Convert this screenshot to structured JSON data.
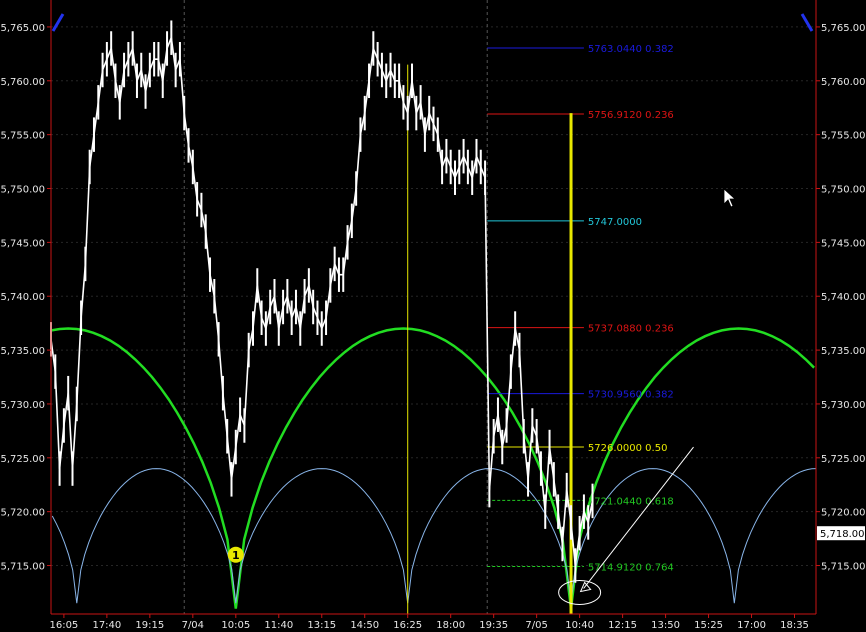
{
  "chart_data": {
    "type": "line",
    "ylim": [
      5710.5,
      5767.5
    ],
    "y_ticks": [
      {
        "label": "5,765.00",
        "value": 5765
      },
      {
        "label": "5,760.00",
        "value": 5760
      },
      {
        "label": "5,755.00",
        "value": 5755
      },
      {
        "label": "5,750.00",
        "value": 5750
      },
      {
        "label": "5,745.00",
        "value": 5745
      },
      {
        "label": "5,740.00",
        "value": 5740
      },
      {
        "label": "5,735.00",
        "value": 5735
      },
      {
        "label": "5,730.00",
        "value": 5730
      },
      {
        "label": "5,725.00",
        "value": 5725
      },
      {
        "label": "5,720.00",
        "value": 5720
      },
      {
        "label": "5,715.00",
        "value": 5715
      }
    ],
    "x_ticks": [
      {
        "label": "16:05",
        "index": 0.6
      },
      {
        "label": "17:40",
        "index": 2.6
      },
      {
        "label": "19:15",
        "index": 4.6
      },
      {
        "label": "7/04",
        "index": 6.6
      },
      {
        "label": "10:05",
        "index": 8.6
      },
      {
        "label": "11:40",
        "index": 10.6
      },
      {
        "label": "13:15",
        "index": 12.6
      },
      {
        "label": "14:50",
        "index": 14.6
      },
      {
        "label": "16:25",
        "index": 16.6
      },
      {
        "label": "18:00",
        "index": 18.6
      },
      {
        "label": "19:35",
        "index": 20.6
      },
      {
        "label": "7/05",
        "index": 22.6
      },
      {
        "label": "10:40",
        "index": 24.6
      },
      {
        "label": "12:15",
        "index": 26.6
      },
      {
        "label": "13:50",
        "index": 28.6
      },
      {
        "label": "15:25",
        "index": 30.6
      },
      {
        "label": "17:00",
        "index": 32.6
      },
      {
        "label": "18:35",
        "index": 34.6
      }
    ],
    "x_range": [
      0,
      35.6
    ],
    "session_breaks": [
      6.2,
      20.3
    ],
    "series": [
      {
        "color": "#ffffff",
        "points": [
          [
            0.0,
            5736
          ],
          [
            0.2,
            5733
          ],
          [
            0.4,
            5724
          ],
          [
            0.6,
            5728
          ],
          [
            0.8,
            5731
          ],
          [
            1.0,
            5724
          ],
          [
            1.2,
            5730
          ],
          [
            1.4,
            5738
          ],
          [
            1.6,
            5743
          ],
          [
            1.8,
            5752
          ],
          [
            2.0,
            5755
          ],
          [
            2.2,
            5758
          ],
          [
            2.4,
            5761
          ],
          [
            2.6,
            5762
          ],
          [
            2.8,
            5763
          ],
          [
            3.0,
            5760
          ],
          [
            3.2,
            5758
          ],
          [
            3.4,
            5761
          ],
          [
            3.6,
            5762
          ],
          [
            3.8,
            5763
          ],
          [
            4.0,
            5760
          ],
          [
            4.2,
            5761
          ],
          [
            4.4,
            5759
          ],
          [
            4.6,
            5761
          ],
          [
            4.8,
            5762
          ],
          [
            5.0,
            5762
          ],
          [
            5.2,
            5760
          ],
          [
            5.4,
            5763
          ],
          [
            5.6,
            5764
          ],
          [
            5.8,
            5761
          ],
          [
            6.0,
            5762
          ],
          [
            6.2,
            5757
          ],
          [
            6.4,
            5754
          ],
          [
            6.6,
            5752
          ],
          [
            6.8,
            5749
          ],
          [
            7.0,
            5748
          ],
          [
            7.2,
            5746
          ],
          [
            7.4,
            5742
          ],
          [
            7.6,
            5740
          ],
          [
            7.8,
            5736
          ],
          [
            8.0,
            5731
          ],
          [
            8.2,
            5727
          ],
          [
            8.4,
            5723
          ],
          [
            8.6,
            5726
          ],
          [
            8.8,
            5729
          ],
          [
            9.0,
            5728
          ],
          [
            9.2,
            5735
          ],
          [
            9.4,
            5737
          ],
          [
            9.6,
            5741
          ],
          [
            9.8,
            5738
          ],
          [
            10.0,
            5737
          ],
          [
            10.2,
            5739
          ],
          [
            10.4,
            5740
          ],
          [
            10.6,
            5737
          ],
          [
            10.8,
            5739
          ],
          [
            11.0,
            5740
          ],
          [
            11.2,
            5738
          ],
          [
            11.4,
            5739
          ],
          [
            11.6,
            5737
          ],
          [
            11.8,
            5740
          ],
          [
            12.0,
            5741
          ],
          [
            12.2,
            5739
          ],
          [
            12.4,
            5738
          ],
          [
            12.6,
            5737
          ],
          [
            12.8,
            5738
          ],
          [
            13.0,
            5741
          ],
          [
            13.2,
            5743
          ],
          [
            13.4,
            5742
          ],
          [
            13.6,
            5742
          ],
          [
            13.8,
            5745
          ],
          [
            14.0,
            5747
          ],
          [
            14.2,
            5750
          ],
          [
            14.4,
            5755
          ],
          [
            14.6,
            5757
          ],
          [
            14.8,
            5760
          ],
          [
            15.0,
            5763
          ],
          [
            15.2,
            5762
          ],
          [
            15.4,
            5761
          ],
          [
            15.6,
            5760
          ],
          [
            15.8,
            5761
          ],
          [
            16.0,
            5760
          ],
          [
            16.2,
            5760
          ],
          [
            16.4,
            5758
          ],
          [
            16.6,
            5757
          ],
          [
            16.8,
            5760
          ],
          [
            17.0,
            5757
          ],
          [
            17.2,
            5758
          ],
          [
            17.4,
            5755
          ],
          [
            17.6,
            5757
          ],
          [
            17.8,
            5756
          ],
          [
            18.0,
            5755
          ],
          [
            18.2,
            5752
          ],
          [
            18.4,
            5753
          ],
          [
            18.6,
            5752
          ],
          [
            18.8,
            5751
          ],
          [
            19.0,
            5752
          ],
          [
            19.2,
            5753
          ],
          [
            19.4,
            5752
          ],
          [
            19.6,
            5751
          ],
          [
            19.8,
            5753
          ],
          [
            20.0,
            5752
          ],
          [
            20.2,
            5751
          ],
          [
            20.4,
            5722
          ],
          [
            20.6,
            5727
          ],
          [
            20.8,
            5729
          ],
          [
            21.0,
            5726
          ],
          [
            21.2,
            5728
          ],
          [
            21.4,
            5733
          ],
          [
            21.6,
            5737
          ],
          [
            21.8,
            5735
          ],
          [
            22.0,
            5727
          ],
          [
            22.2,
            5723
          ],
          [
            22.4,
            5728
          ],
          [
            22.6,
            5727
          ],
          [
            22.8,
            5724
          ],
          [
            23.0,
            5720
          ],
          [
            23.2,
            5726
          ],
          [
            23.4,
            5723
          ],
          [
            23.6,
            5720
          ],
          [
            23.8,
            5717
          ],
          [
            24.0,
            5722
          ],
          [
            24.2,
            5719
          ],
          [
            24.4,
            5715
          ],
          [
            24.6,
            5718
          ],
          [
            24.8,
            5720
          ],
          [
            25.0,
            5719
          ],
          [
            25.2,
            5721
          ]
        ]
      }
    ],
    "fib_levels": [
      {
        "label": "5763.0440 0.382",
        "value": 5763.044,
        "color": "#1a1adc",
        "dashed": false
      },
      {
        "label": "5756.9120 0.236",
        "value": 5756.912,
        "color": "#dc1414",
        "dashed": false
      },
      {
        "label": "5747.0000",
        "value": 5747.0,
        "color": "#22c6d8",
        "dashed": false
      },
      {
        "label": "5737.0880 0.236",
        "value": 5737.088,
        "color": "#dc1414",
        "dashed": false
      },
      {
        "label": "5730.9560 0.382",
        "value": 5730.956,
        "color": "#1a1adc",
        "dashed": false
      },
      {
        "label": "5726.0000 0.50",
        "value": 5726.0,
        "color": "#e8e800",
        "dashed": false
      },
      {
        "label": "5721.0440 0.618",
        "value": 5721.044,
        "color": "#22c822",
        "dashed": true
      },
      {
        "label": "5714.9120 0.764",
        "value": 5714.912,
        "color": "#22c822",
        "dashed": true
      }
    ],
    "fib_x_range": [
      20.3,
      24.8
    ],
    "vertical_markers": [
      {
        "x": 16.6,
        "from": 5710.5,
        "to": 5761.5,
        "color": "#e8e800"
      },
      {
        "x": 24.2,
        "from": 5710.5,
        "to": 5757.0,
        "color": "#e8e800"
      }
    ],
    "cycle_arcs": [
      {
        "color": "#22dd22",
        "troughs": [
          8.6,
          24.2
        ],
        "period": 15.6,
        "peak": 5737.0,
        "trough": 5711.0
      },
      {
        "color": "#88b4e8",
        "troughs": [
          1.2,
          8.6,
          16.6,
          24.2,
          31.8
        ],
        "period": 7.6,
        "peak": 5724.0,
        "trough": 5711.5
      }
    ],
    "last_price_label": "5,718.00",
    "last_price": 5718.0,
    "marker_glyph": "1",
    "marker": {
      "x": 8.6,
      "y": 5716.0
    }
  }
}
